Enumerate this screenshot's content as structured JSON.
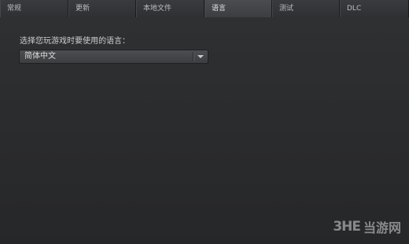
{
  "tabs": [
    {
      "label": "常规",
      "active": false
    },
    {
      "label": "更新",
      "active": false
    },
    {
      "label": "本地文件",
      "active": false
    },
    {
      "label": "语言",
      "active": true
    },
    {
      "label": "测试",
      "active": false
    },
    {
      "label": "DLC",
      "active": false
    }
  ],
  "language": {
    "prompt": "选择您玩游戏时要使用的语言：",
    "selected": "简体中文"
  },
  "watermark": {
    "logo": "3HE",
    "text": "当游网"
  }
}
